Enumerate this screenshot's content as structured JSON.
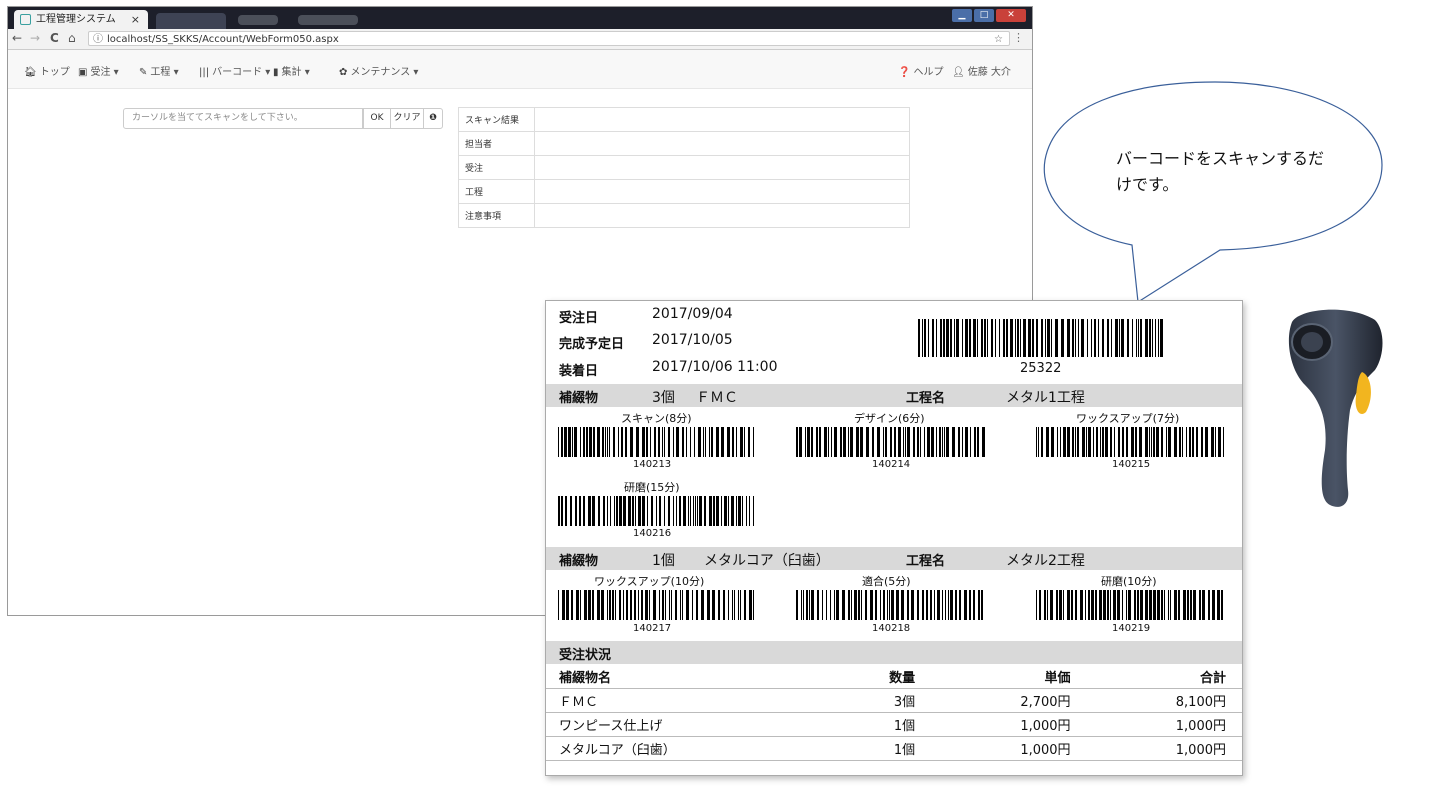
{
  "browser": {
    "tab_title": "工程管理システム",
    "tab_close": "×",
    "url": "localhost/SS_SKKS/Account/WebForm050.aspx",
    "nav_back": "←",
    "nav_forward": "→",
    "nav_reload": "C",
    "nav_home": "⌂",
    "info_icon": "ⓘ",
    "star": "☆",
    "menu": "⋮"
  },
  "app_nav": {
    "items": [
      {
        "icon": "home-icon",
        "label": "トップ"
      },
      {
        "icon": "briefcase-icon",
        "label": "受注 ▾"
      },
      {
        "icon": "wrench-icon",
        "label": "工程 ▾"
      },
      {
        "icon": "barcode-icon",
        "label": "バーコード ▾"
      },
      {
        "icon": "chart-icon",
        "label": "集計 ▾"
      },
      {
        "icon": "gear-icon",
        "label": "メンテナンス ▾"
      }
    ],
    "help": "ヘルプ",
    "user": "佐藤 大介"
  },
  "scan": {
    "placeholder": "カーソルを当ててスキャンをして下さい。",
    "ok": "OK",
    "clear": "クリア",
    "info": "❶"
  },
  "result_table": [
    {
      "label": "スキャン結果",
      "value": ""
    },
    {
      "label": "担当者",
      "value": ""
    },
    {
      "label": "受注",
      "value": ""
    },
    {
      "label": "工程",
      "value": ""
    },
    {
      "label": "注意事項",
      "value": ""
    }
  ],
  "bubble": {
    "text": "バーコードをスキャンするだけです。"
  },
  "card": {
    "order_date_label": "受注日",
    "order_date": "2017/09/04",
    "complete_label": "完成予定日",
    "complete_date": "2017/10/05",
    "install_label": "装着日",
    "install_date": "2017/10/06 11:00",
    "order_barcode": "25322",
    "groups": [
      {
        "item_label": "補綴物",
        "qty": "3個",
        "item_name": "ＦＭＣ",
        "process_label": "工程名",
        "process_name": "メタル1工程",
        "steps": [
          {
            "name": "スキャン(8分)",
            "code": "140213"
          },
          {
            "name": "デザイン(6分)",
            "code": "140214"
          },
          {
            "name": "ワックスアップ(7分)",
            "code": "140215"
          },
          {
            "name": "研磨(15分)",
            "code": "140216"
          }
        ]
      },
      {
        "item_label": "補綴物",
        "qty": "1個",
        "item_name": "メタルコア（臼歯）",
        "process_label": "工程名",
        "process_name": "メタル2工程",
        "steps": [
          {
            "name": "ワックスアップ(10分)",
            "code": "140217"
          },
          {
            "name": "適合(5分)",
            "code": "140218"
          },
          {
            "name": "研磨(10分)",
            "code": "140219"
          }
        ]
      }
    ],
    "status_title": "受注状況",
    "status_cols": [
      "補綴物名",
      "数量",
      "単価",
      "合計"
    ],
    "status_rows": [
      [
        "ＦＭＣ",
        "3個",
        "2,700円",
        "8,100円"
      ],
      [
        "ワンピース仕上げ",
        "1個",
        "1,000円",
        "1,000円"
      ],
      [
        "メタルコア（臼歯）",
        "1個",
        "1,000円",
        "1,000円"
      ]
    ]
  }
}
